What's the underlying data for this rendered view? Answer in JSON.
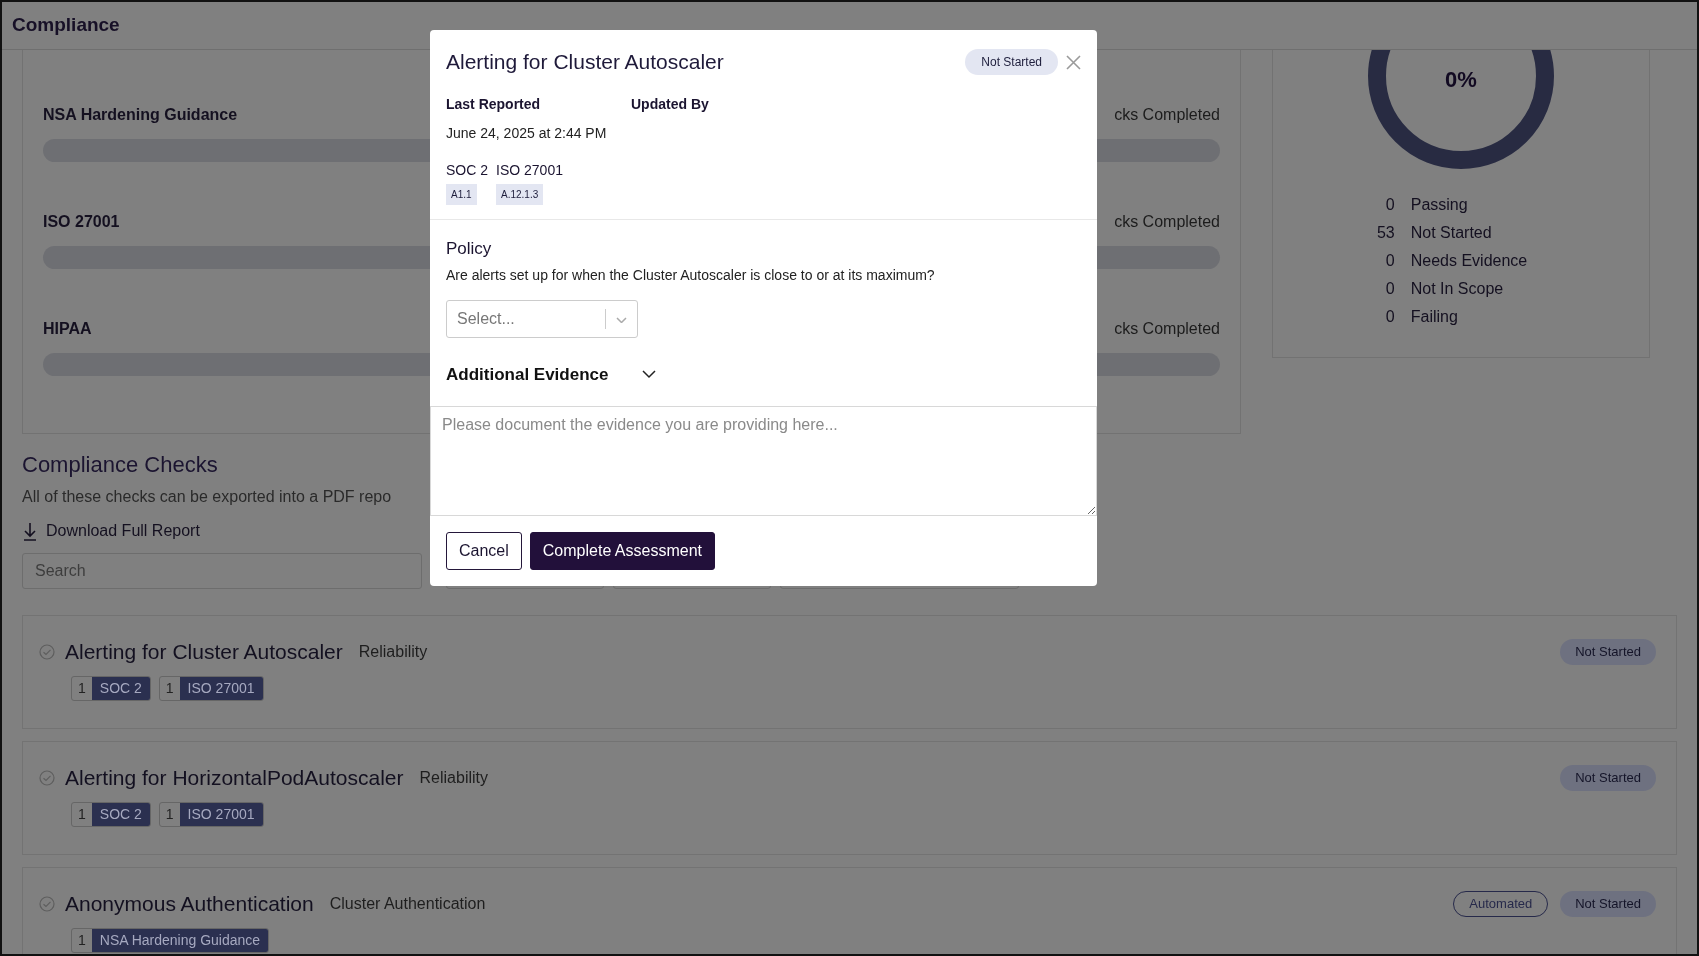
{
  "header": {
    "title": "Compliance"
  },
  "frameworks": [
    {
      "name": "NSA Hardening Guidance",
      "progress_text": "cks Completed",
      "level": 0
    },
    {
      "name": "ISO 27001",
      "progress_text": "cks Completed",
      "level": 0
    },
    {
      "name": "HIPAA",
      "progress_text": "cks Completed",
      "level": 0
    }
  ],
  "summary": {
    "percent": "0%",
    "stats": [
      {
        "count": "0",
        "label": "Passing"
      },
      {
        "count": "53",
        "label": "Not Started"
      },
      {
        "count": "0",
        "label": "Needs Evidence"
      },
      {
        "count": "0",
        "label": "Not In Scope"
      },
      {
        "count": "0",
        "label": "Failing"
      }
    ]
  },
  "checks_section": {
    "title": "Compliance Checks",
    "description": "All of these checks can be exported into a PDF repo",
    "download": "Download Full Report",
    "search": {
      "placeholder": "Search"
    },
    "filters": [
      {
        "kind": "select"
      },
      {
        "kind": "select"
      },
      {
        "kind": "select"
      }
    ]
  },
  "checks": [
    {
      "title": "Alerting for Cluster Autoscaler",
      "category": "Reliability",
      "tags": [
        {
          "count": "1",
          "name": "SOC 2"
        },
        {
          "count": "1",
          "name": "ISO 27001"
        }
      ],
      "badges": [
        {
          "kind": "status",
          "text": "Not Started"
        }
      ]
    },
    {
      "title": "Alerting for HorizontalPodAutoscaler",
      "category": "Reliability",
      "tags": [
        {
          "count": "1",
          "name": "SOC 2"
        },
        {
          "count": "1",
          "name": "ISO 27001"
        }
      ],
      "badges": [
        {
          "kind": "status",
          "text": "Not Started"
        }
      ]
    },
    {
      "title": "Anonymous Authentication",
      "category": "Cluster Authentication",
      "tags": [
        {
          "count": "1",
          "name": "NSA Hardening Guidance"
        }
      ],
      "badges": [
        {
          "kind": "outline",
          "text": "Automated"
        },
        {
          "kind": "status",
          "text": "Not Started"
        }
      ]
    }
  ],
  "modal": {
    "title": "Alerting for Cluster Autoscaler",
    "status": "Not Started",
    "meta": [
      {
        "label": "Last Reported",
        "value": "June 24, 2025 at 2:44 PM"
      },
      {
        "label": "Updated By"
      }
    ],
    "controls": [
      {
        "framework": "SOC 2",
        "control": "A1.1"
      },
      {
        "framework": "ISO 27001",
        "control": "A.12.1.3"
      }
    ],
    "policy_title": "Policy",
    "question": "Are alerts set up for when the Cluster Autoscaler is close to or at its maximum?",
    "select": {
      "placeholder": "Select..."
    },
    "evidence": {
      "title": "Additional Evidence",
      "expanded": true,
      "placeholder": "Please document the evidence you are providing here..."
    },
    "buttons": [
      {
        "kind": "secondary",
        "label": "Cancel"
      },
      {
        "kind": "primary",
        "label": "Complete Assessment"
      }
    ]
  }
}
